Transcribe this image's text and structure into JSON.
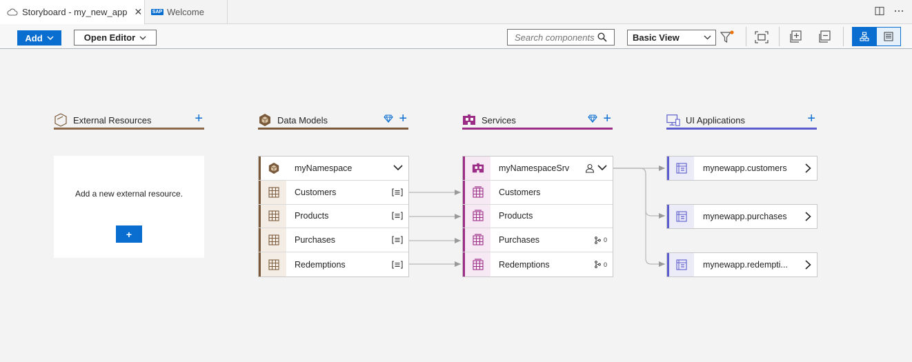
{
  "tabs": [
    {
      "label": "Storyboard - my_new_app",
      "icon": "cloud-icon",
      "active": true
    },
    {
      "label": "Welcome",
      "icon": "sap-logo-icon",
      "active": false
    }
  ],
  "sap_logo_text": "SAP",
  "toolbar": {
    "add_label": "Add",
    "open_editor_label": "Open Editor",
    "search_placeholder": "Search components",
    "view_select_value": "Basic View"
  },
  "columns": {
    "external": {
      "title": "External Resources",
      "color": "#8b6a4a"
    },
    "datamodels": {
      "title": "Data Models",
      "color": "#7a5a3a"
    },
    "services": {
      "title": "Services",
      "color": "#9c2d86"
    },
    "ui": {
      "title": "UI Applications",
      "color": "#5b5ccd"
    }
  },
  "external_card": {
    "message": "Add a new external resource.",
    "add_button": "+"
  },
  "data_models": {
    "namespace": "myNamespace",
    "entities": [
      "Customers",
      "Products",
      "Purchases",
      "Redemptions"
    ]
  },
  "services": {
    "name": "myNamespaceSrv",
    "entities": [
      "Customers",
      "Products",
      "Purchases",
      "Redemptions"
    ],
    "action_counts": [
      "",
      "",
      "0",
      "0"
    ]
  },
  "ui_apps": [
    "mynewapp.customers",
    "mynewapp.purchases",
    "mynewapp.redempti..."
  ],
  "colors": {
    "accent": "#0a6ed1",
    "notification_dot": "#e9730c",
    "datamodel_brown": "#7a5a3a",
    "service_purple": "#9c2d86",
    "ui_indigo": "#5b5ccd"
  }
}
